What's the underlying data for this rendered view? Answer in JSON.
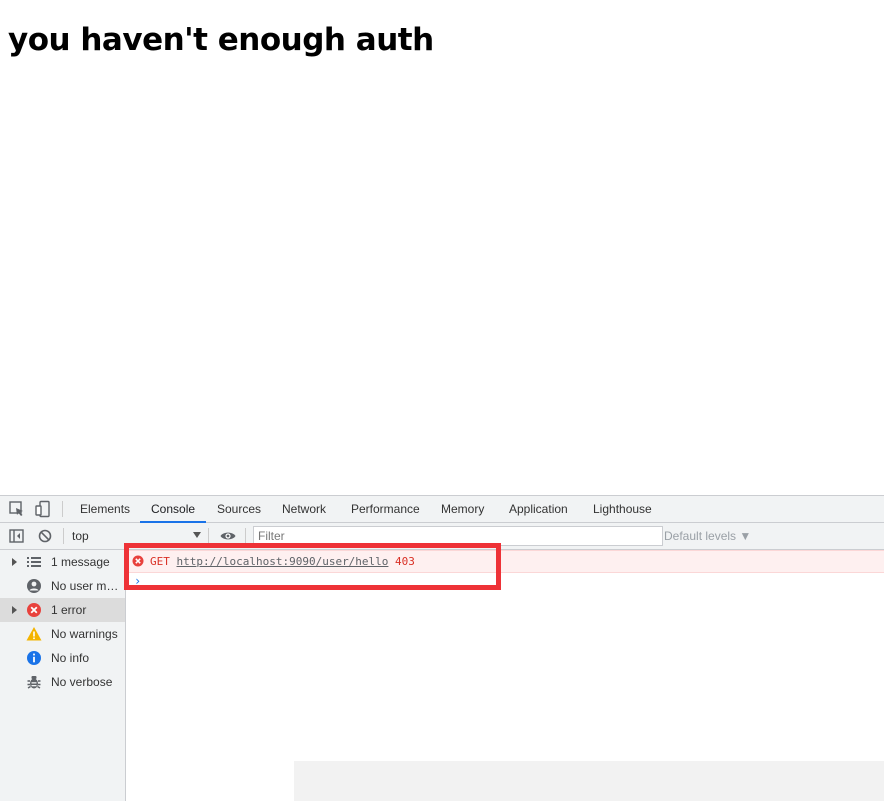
{
  "page": {
    "heading": "you haven't enough auth"
  },
  "devtools": {
    "tabs": [
      {
        "label": "Elements"
      },
      {
        "label": "Console"
      },
      {
        "label": "Sources"
      },
      {
        "label": "Network"
      },
      {
        "label": "Performance"
      },
      {
        "label": "Memory"
      },
      {
        "label": "Application"
      },
      {
        "label": "Lighthouse"
      }
    ],
    "active_tab": "Console",
    "toolbar": {
      "context": "top",
      "filter_placeholder": "Filter",
      "levels_label": "Default levels ▼"
    },
    "sidebar": {
      "items": [
        {
          "label": "1 message",
          "icon": "list-icon"
        },
        {
          "label": "No user me...",
          "icon": "user-icon"
        },
        {
          "label": "1 error",
          "icon": "error-icon"
        },
        {
          "label": "No warnings",
          "icon": "warning-icon"
        },
        {
          "label": "No info",
          "icon": "info-icon"
        },
        {
          "label": "No verbose",
          "icon": "bug-icon"
        }
      ]
    },
    "console": {
      "error": {
        "method": "GET",
        "url": "http://localhost:9090/user/hello",
        "status": "403"
      },
      "prompt": "›"
    },
    "colors": {
      "error": "#d93025",
      "accent": "#1a73e8",
      "highlight": "#ee3237"
    }
  }
}
